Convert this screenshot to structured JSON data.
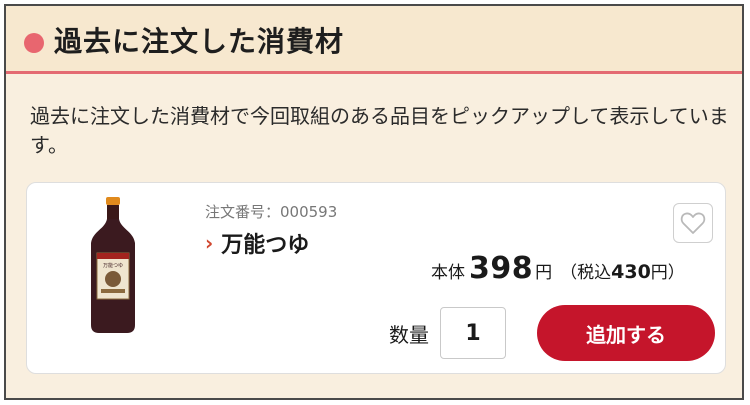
{
  "section": {
    "title": "過去に注文した消費材",
    "description": "過去に注文した消費材で今回取組のある品目をピックアップして表示しています。"
  },
  "product": {
    "image_label": "万能つゆ",
    "order_number": "注文番号：000593",
    "name": "万能つゆ",
    "price": {
      "label": "本体",
      "value": "398",
      "unit": "円",
      "tax_open": "（",
      "tax_label": "税込",
      "tax_value": "430",
      "tax_unit": "円",
      "tax_close": "）"
    },
    "quantity_label": "数量",
    "quantity_value": "1",
    "add_button_label": "追加する",
    "favorite_icon": "heart-outline-icon"
  },
  "colors": {
    "accent": "#e8666f",
    "button": "#c5152b",
    "header_bg": "#f7e8cf",
    "panel_bg": "#f9efdf"
  }
}
